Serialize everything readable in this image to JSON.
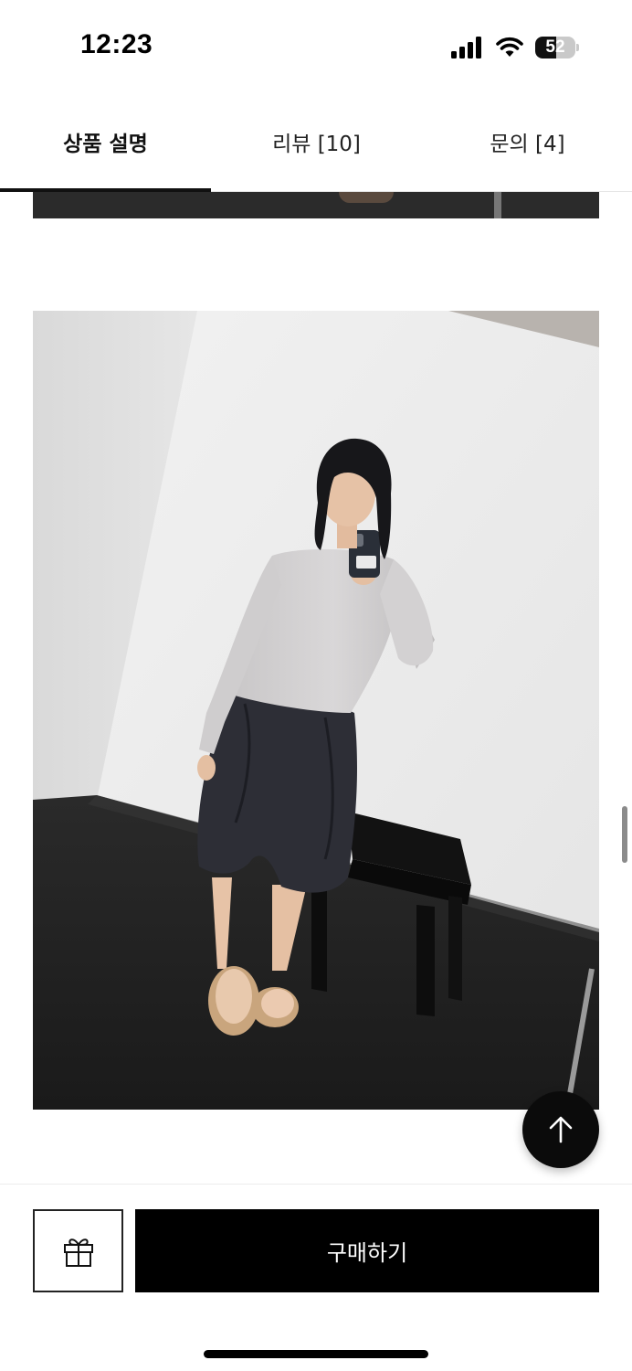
{
  "status_bar": {
    "time": "12:23",
    "battery_level": "52",
    "icons": [
      "cellular-signal-icon",
      "wifi-icon",
      "battery-icon"
    ]
  },
  "tabs": [
    {
      "label": "상품 설명",
      "active": true
    },
    {
      "label": "리뷰 [10]",
      "active": false
    },
    {
      "label": "문의 [4]",
      "active": false
    }
  ],
  "content": {
    "images": [
      {
        "name": "product-photo-previous",
        "visible": "cropped"
      },
      {
        "name": "product-photo-model"
      }
    ]
  },
  "scroll_to_top": {
    "icon": "arrow-up-icon"
  },
  "bottom_bar": {
    "gift_icon": "gift-icon",
    "buy_label": "구매하기"
  },
  "colors": {
    "accent": "#000000",
    "background": "#ffffff",
    "tab_indicator": "#111111"
  }
}
